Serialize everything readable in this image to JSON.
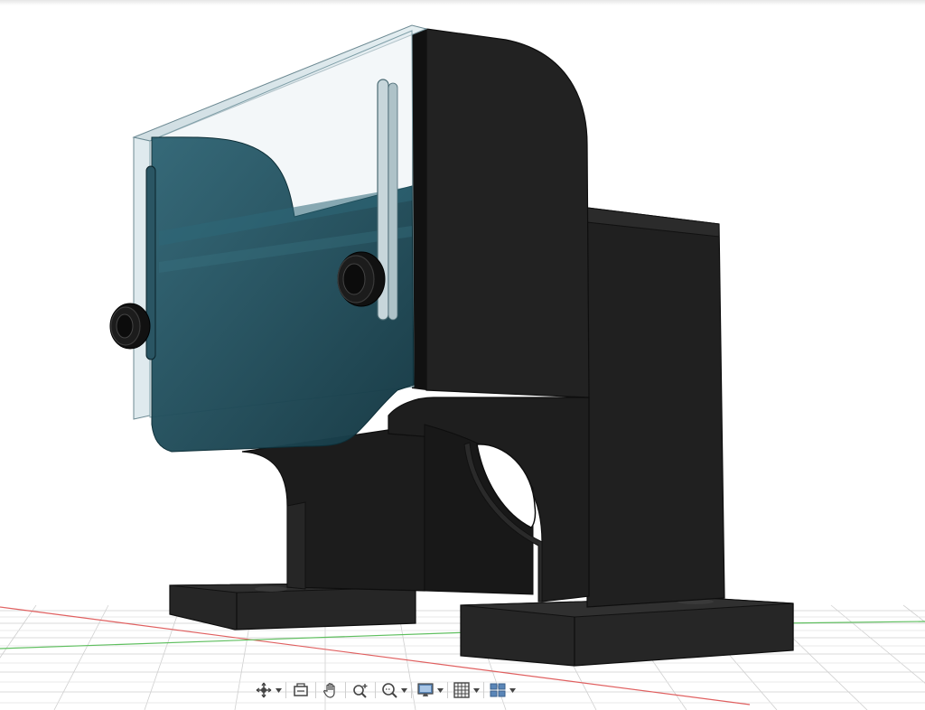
{
  "viewport": {
    "background": "#ffffff",
    "grid_color": "#c8c8c8",
    "x_axis_color": "#e06060",
    "y_axis_color": "#5fbf5f"
  },
  "model": {
    "body_color": "#1e1e1e",
    "glass_color": "#1f4f5e",
    "glass_edge_color": "#9fc4cf"
  },
  "nav_toolbar": {
    "tools": [
      {
        "icon": "orbit-icon",
        "has_menu": true
      },
      {
        "icon": "look-at-icon",
        "has_menu": false
      },
      {
        "icon": "pan-hand-icon",
        "has_menu": false
      },
      {
        "icon": "zoom-icon",
        "has_menu": false
      },
      {
        "icon": "fit-window-icon",
        "has_menu": true
      },
      {
        "icon": "display-settings-icon",
        "has_menu": true
      },
      {
        "icon": "grid-snap-icon",
        "has_menu": true
      },
      {
        "icon": "viewports-icon",
        "has_menu": true
      }
    ]
  }
}
